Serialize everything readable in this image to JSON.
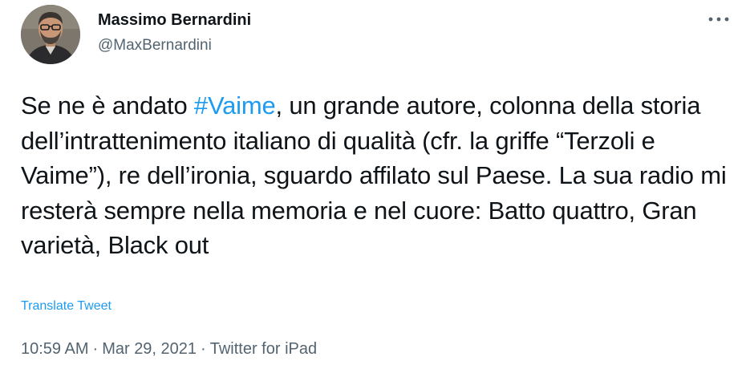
{
  "author": {
    "display_name": "Massimo Bernardini",
    "handle": "@MaxBernardini"
  },
  "tweet": {
    "text_before": "Se ne è andato ",
    "hashtag": "#Vaime",
    "text_after": ", un grande autore, colonna della storia dell’intrattenimento italiano di qualità (cfr. la griffe “Terzoli e Vaime”), re dell’ironia, sguardo affilato sul Paese. La sua radio mi resterà sempre nella memoria e nel cuore: Batto quattro, Gran varietà, Black out",
    "translate_label": "Translate Tweet"
  },
  "meta": {
    "time": "10:59 AM",
    "separator": "·",
    "date": "Mar 29, 2021",
    "source": "Twitter for iPad"
  },
  "icons": {
    "more": "more-horizontal-icon",
    "avatar": "profile-photo"
  },
  "colors": {
    "link": "#1d9bf0",
    "secondary_text": "#536471",
    "primary_text": "#0f1419"
  }
}
